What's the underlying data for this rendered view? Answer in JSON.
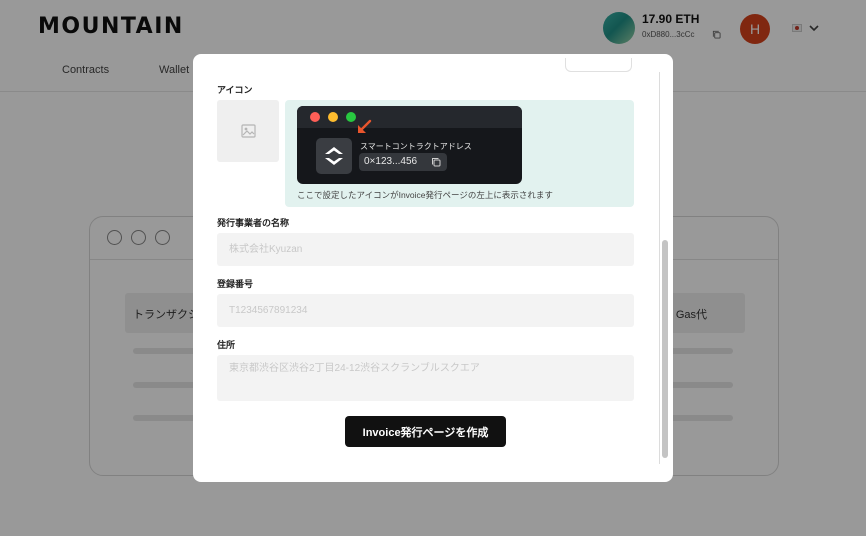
{
  "app": {
    "logo_text": "MOUNTAIN",
    "nav": {
      "contracts": "Contracts",
      "wallet": "Wallet"
    },
    "wallet": {
      "balance": "17.90 ETH",
      "address": "0xD880...3cCc"
    },
    "user_initial": "H",
    "background_table": {
      "header_left": "トランザクシ",
      "header_right": "Gas代"
    }
  },
  "modal": {
    "icon_label": "アイコン",
    "preview": {
      "sc_label": "スマートコントラクトアドレス",
      "address": "0×123...456",
      "caption": "ここで設定したアイコンがInvoice発行ページの左上に表示されます"
    },
    "issuer_label": "発行事業者の名称",
    "issuer_placeholder": "株式会社Kyuzan",
    "registration_label": "登録番号",
    "registration_placeholder": "T1234567891234",
    "address_label": "住所",
    "address_placeholder": "東京都渋谷区渋谷2丁目24-12渋谷スクランブルスクエア",
    "submit_label": "Invoice発行ページを作成"
  },
  "colors": {
    "overlay": "#000000",
    "preview_bg": "#e2f2ef",
    "preview_window": "#15171b",
    "traffic_red": "#ff5f57",
    "traffic_yellow": "#febc2e",
    "traffic_green": "#28c840",
    "arrow": "#e8552d",
    "avatar": "#d5421b",
    "button": "#111111"
  },
  "icons": [
    "image-placeholder-icon",
    "copy-icon",
    "chevron-down-icon",
    "arrow-icon",
    "contract-logo-icon",
    "flag-icon"
  ]
}
